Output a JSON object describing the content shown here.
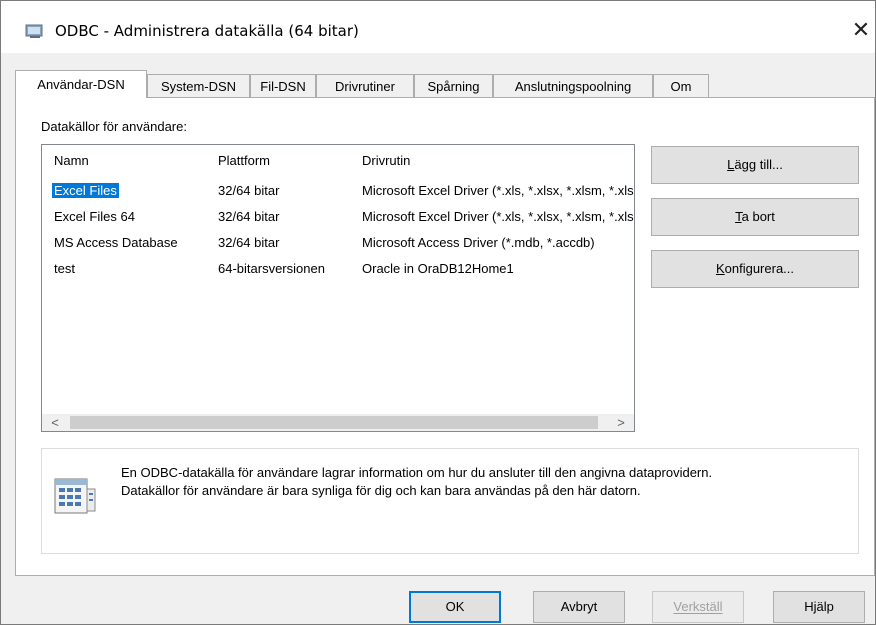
{
  "window": {
    "title": "ODBC - Administrera datakälla (64 bitar)",
    "close": "✕"
  },
  "tabs": [
    {
      "label": "Användar-DSN"
    },
    {
      "label": "System-DSN"
    },
    {
      "label": "Fil-DSN"
    },
    {
      "label": "Drivrutiner"
    },
    {
      "label": "Spårning"
    },
    {
      "label": "Anslutningspoolning"
    },
    {
      "label": "Om"
    }
  ],
  "panel": {
    "group_label": "Datakällor för användare:",
    "columns": [
      "Namn",
      "Plattform",
      "Drivrutin"
    ],
    "rows": [
      {
        "name": "Excel Files",
        "platform": "32/64 bitar",
        "driver": "Microsoft Excel Driver (*.xls, *.xlsx, *.xlsm, *.xlsb)"
      },
      {
        "name": "Excel Files 64",
        "platform": "32/64 bitar",
        "driver": "Microsoft Excel Driver (*.xls, *.xlsx, *.xlsm, *.xlsb)"
      },
      {
        "name": "MS Access Database",
        "platform": "32/64 bitar",
        "driver": "Microsoft Access Driver (*.mdb, *.accdb)"
      },
      {
        "name": "test",
        "platform": "64-bitarsversionen",
        "driver": "Oracle in OraDB12Home1"
      }
    ],
    "scroll_left": "<",
    "scroll_right": ">"
  },
  "side_buttons": {
    "add": {
      "label": "Lägg till...",
      "mnemonic_index": 0
    },
    "remove": {
      "label": "Ta bort",
      "mnemonic_index": 0
    },
    "configure": {
      "label": "Konfigurera...",
      "mnemonic_index": 0
    }
  },
  "info": {
    "line1": "En ODBC-datakälla för användare lagrar information om hur du ansluter till den angivna dataprovidern.",
    "line2": "Datakällor för användare är bara synliga för dig och kan bara användas på den här datorn."
  },
  "footer": {
    "ok": "OK",
    "cancel": "Avbryt",
    "apply": "Verkställ",
    "help": "Hjälp"
  },
  "colors": {
    "selection": "#0078d7",
    "default_button_border": "#0078d7"
  }
}
